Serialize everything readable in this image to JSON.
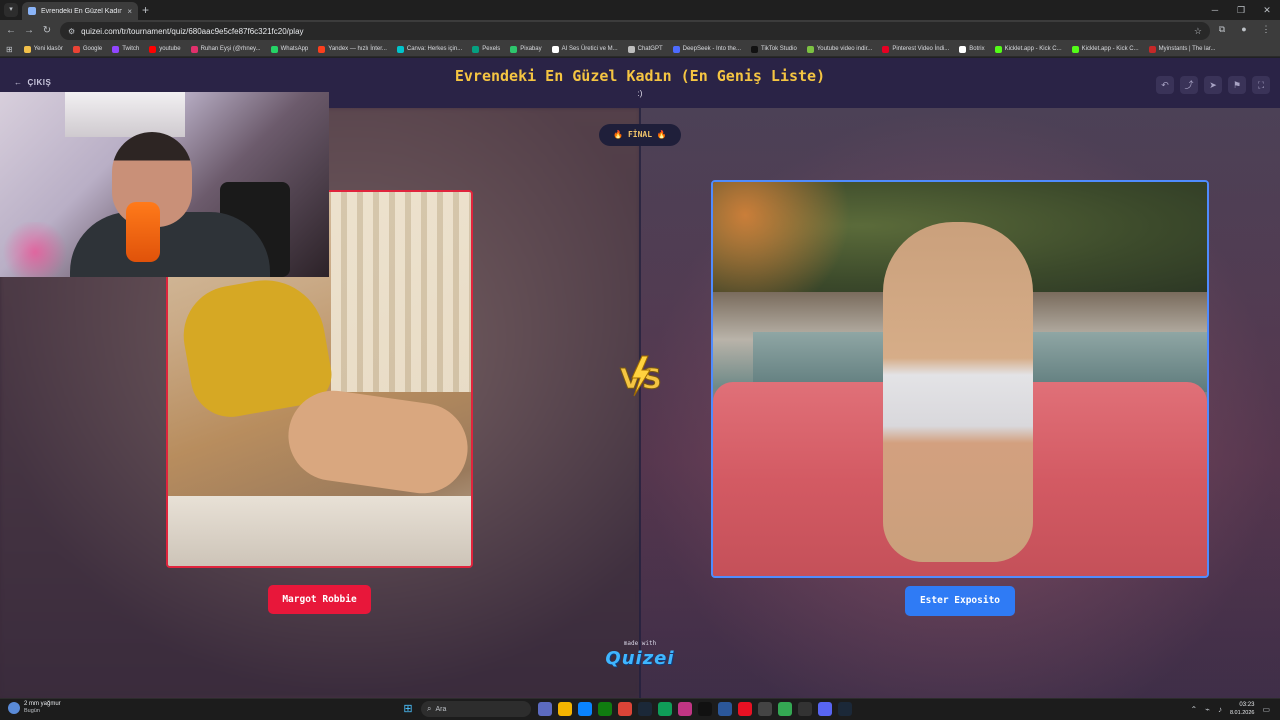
{
  "browser": {
    "tab_title": "Evrendeki En Güzel Kadın (En G",
    "tab_close": "×",
    "new_tab": "+",
    "url": "quizei.com/tr/tournament/quiz/680aac9e5cfe87f6c321fc20/play"
  },
  "bookmarks": [
    {
      "label": "Yeni klasör",
      "color": "#f1c04a"
    },
    {
      "label": "Google",
      "color": "#ea4335"
    },
    {
      "label": "Twitch",
      "color": "#9146ff"
    },
    {
      "label": "youtube",
      "color": "#ff0000"
    },
    {
      "label": "Ruhan Eyşi (@rhney...",
      "color": "#e1306c"
    },
    {
      "label": "WhatsApp",
      "color": "#25d366"
    },
    {
      "label": "Yandex — hızlı İnter...",
      "color": "#fc3f1d"
    },
    {
      "label": "Canva: Herkes için...",
      "color": "#00c4cc"
    },
    {
      "label": "Pexels",
      "color": "#05a081"
    },
    {
      "label": "Pixabay",
      "color": "#2ec66d"
    },
    {
      "label": "AI Ses Üretici ve M...",
      "color": "#ffffff"
    },
    {
      "label": "ChatGPT",
      "color": "#bdbdbd"
    },
    {
      "label": "DeepSeek - Into the...",
      "color": "#4d6bfe"
    },
    {
      "label": "TikTok Studio",
      "color": "#111111"
    },
    {
      "label": "Youtube video indir...",
      "color": "#7cc242"
    },
    {
      "label": "Pinterest Video İndi...",
      "color": "#e60023"
    },
    {
      "label": "Botrix",
      "color": "#ffffff"
    },
    {
      "label": "Kicklet.app - Kick C...",
      "color": "#53fc18"
    },
    {
      "label": "Kicklet.app - Kick C...",
      "color": "#53fc18"
    },
    {
      "label": "Myinstants | The lar...",
      "color": "#c62828"
    }
  ],
  "page": {
    "exit_label": "ÇIKIŞ",
    "title": "Evrendeki En Güzel Kadın (En Geniş Liste)",
    "subtitle": ":)",
    "final_label": "🔥 FİNAL 🔥",
    "vs_label": "VS",
    "left_contestant": "Margot Robbie",
    "right_contestant": "Ester Exposito",
    "made_with": "made with",
    "brand": "Quizei"
  },
  "taskbar": {
    "weather_line1": "2 mm yağmur",
    "weather_line2": "Bugün",
    "search_placeholder": "Ara",
    "time": "03:23",
    "date": "8.01.2026"
  },
  "colors": {
    "title": "#f5c542",
    "left_accent": "#e8173a",
    "right_accent": "#2f7bf5",
    "header_bg": "#2a2346"
  }
}
